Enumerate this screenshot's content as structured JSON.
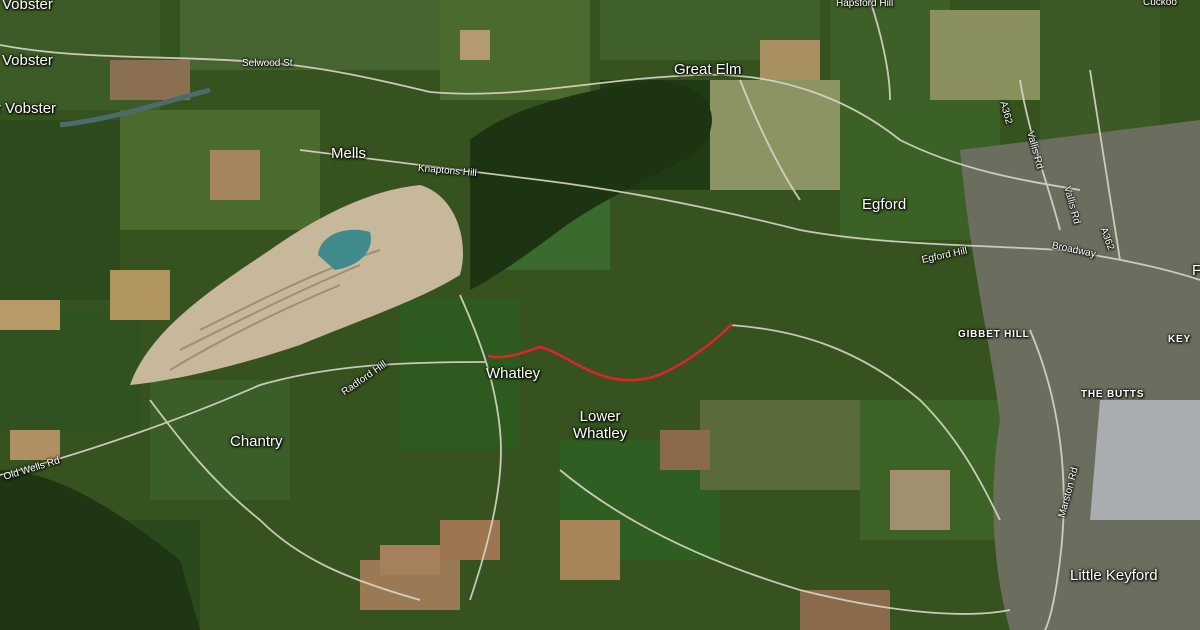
{
  "map": {
    "type": "satellite",
    "route_color": "#e0242a",
    "places": {
      "vobster": "Vobster",
      "r_vobster": "r Vobster",
      "mells": "Mells",
      "great_elm": "Great Elm",
      "egford": "Egford",
      "whatley": "Whatley",
      "lower_whatley": "Lower\nWhatley",
      "chantry": "Chantry",
      "little_keyford": "Little Keyford",
      "cuckoo": "Cuckoo",
      "f_edge": "F",
      "keyf_edge": "KEY"
    },
    "districts": {
      "gibbet_hill": "GIBBET HILL",
      "the_butts": "THE BUTTS"
    },
    "roads": {
      "selwood_st": "Selwood St",
      "knaptons_hill": "Knaptons Hill",
      "hapsford_hill": "Hapsford Hill",
      "a362_north": "A362",
      "vallis_rd_north": "Vallis Rd",
      "vallis_rd_south": "Vallis Rd",
      "a362_south": "A362",
      "egford_hill": "Egford Hill",
      "broadway": "Broadway",
      "radford_hill": "Radford Hill",
      "old_wells_rd": "Old Wells Rd",
      "marston_rd": "Marston Rd"
    }
  }
}
